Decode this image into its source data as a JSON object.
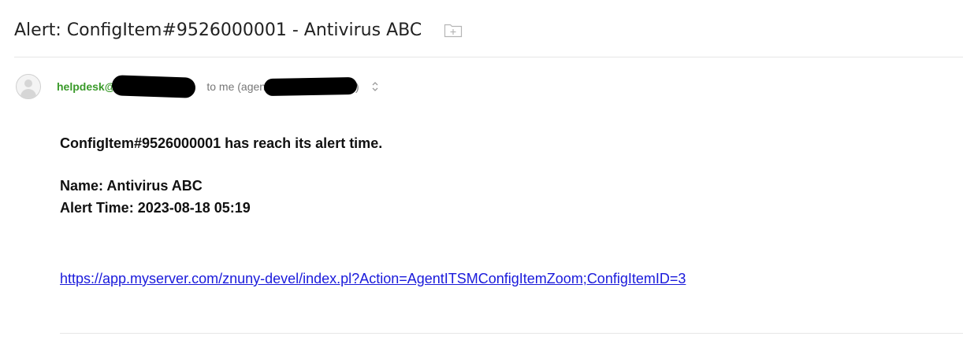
{
  "subject": {
    "title": "Alert: ConfigItem#9526000001 - Antivirus ABC",
    "folder_icon": "add-to-folder-icon"
  },
  "sender": {
    "avatar_icon": "person-avatar-icon",
    "from_prefix": "helpdesk@",
    "to_text": "to me (agent",
    "close_paren": ")",
    "expand_icon": "expand-details-icon",
    "sender_color": "#3a9a2a"
  },
  "message": {
    "line1": "ConfigItem#9526000001 has reach its alert time.",
    "name_line": "Name: Antivirus ABC",
    "alert_time_line": "Alert Time: 2023-08-18 05:19",
    "link_text": "https://app.myserver.com/znuny-devel/index.pl?Action=AgentITSMConfigItemZoom;ConfigItemID=3",
    "link_color": "#1a1adb"
  }
}
